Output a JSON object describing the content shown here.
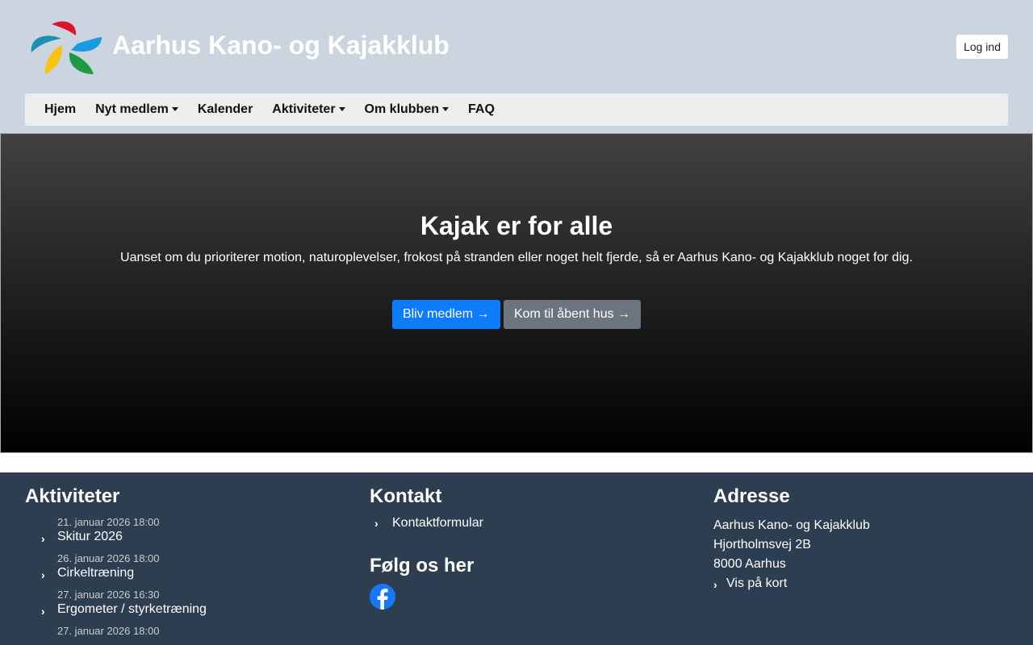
{
  "header": {
    "title": "Aarhus Kano- og Kajakklub",
    "login": "Log ind"
  },
  "nav": [
    {
      "label": "Hjem"
    },
    {
      "label": "Nyt medlem",
      "dropdown": true
    },
    {
      "label": "Kalender"
    },
    {
      "label": "Aktiviteter",
      "dropdown": true
    },
    {
      "label": "Om klubben",
      "dropdown": true
    },
    {
      "label": "FAQ"
    }
  ],
  "hero": {
    "title": "Kajak er for alle",
    "text": "Uanset om du prioriterer motion, naturoplevelser, frokost på stranden eller noget helt fjerde, så er Aarhus Kano- og Kajakklub noget for dig.",
    "primary": "Bliv medlem →",
    "secondary": "Kom til åbent hus →"
  },
  "footer": {
    "activities": {
      "title": "Aktiviteter",
      "items": [
        {
          "date": "21. januar 2026 18:00",
          "title": "Skitur 2026"
        },
        {
          "date": "26. januar 2026 18:00",
          "title": "Cirkeltræning"
        },
        {
          "date": "27. januar 2026 16:30",
          "title": "Ergometer / styrketræning"
        },
        {
          "date": "27. januar 2026 18:00",
          "title": ""
        }
      ]
    },
    "contact": {
      "title": "Kontakt",
      "link": "Kontaktformular",
      "follow": "Følg os her"
    },
    "address": {
      "title": "Adresse",
      "name": "Aarhus Kano- og Kajakklub",
      "street": "Hjortholmsvej 2B",
      "city": "8000 Aarhus",
      "map": "Vis på kort"
    }
  }
}
